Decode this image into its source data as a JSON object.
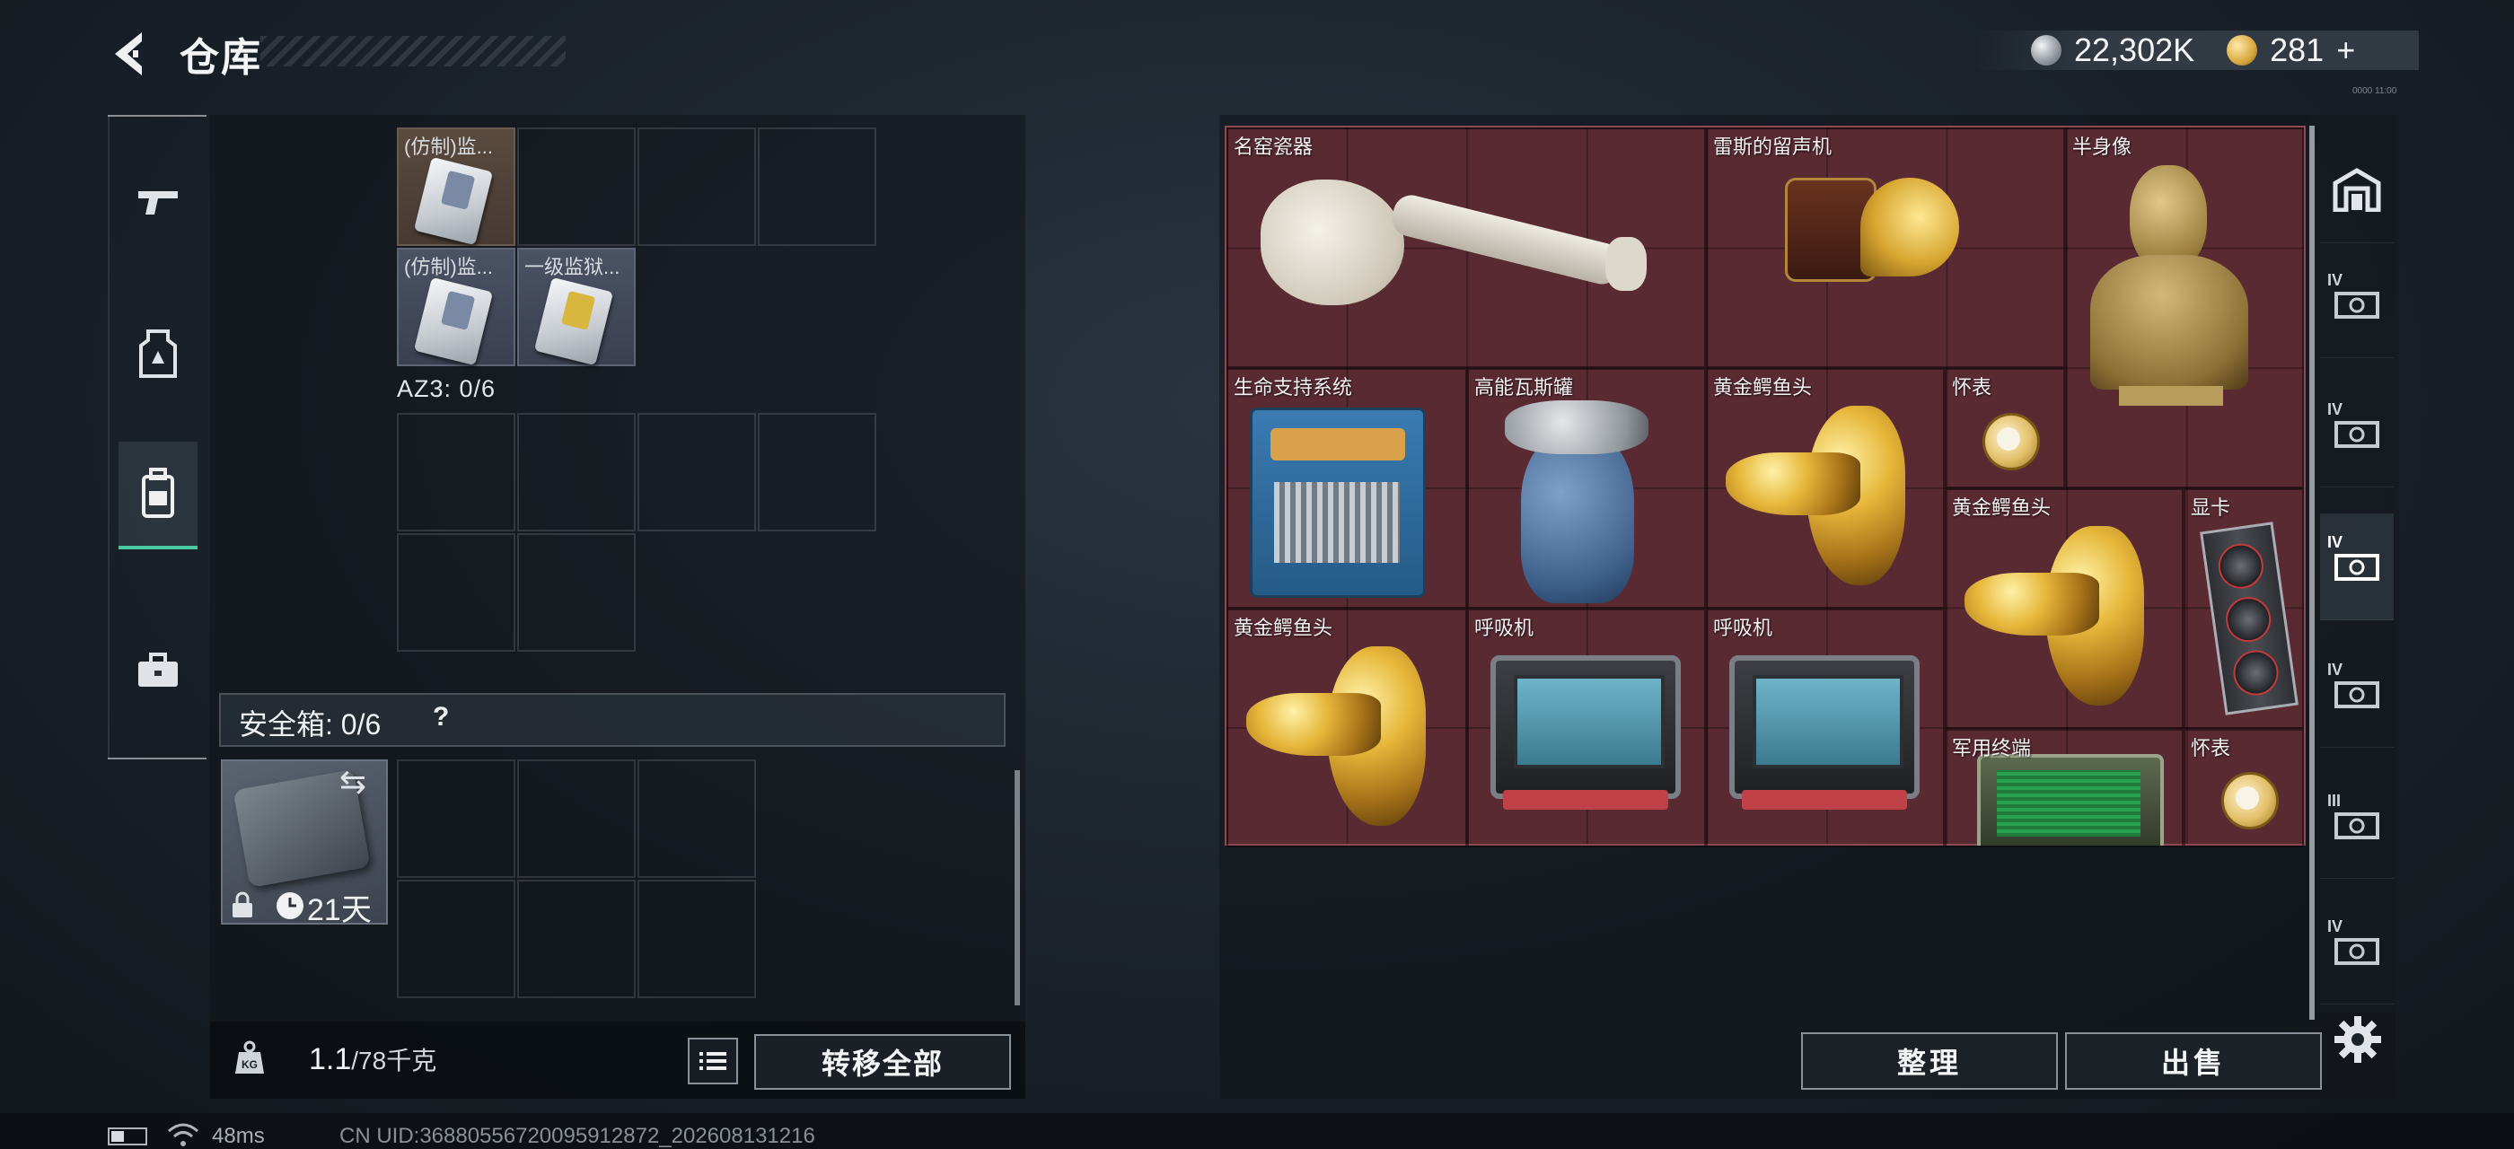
{
  "header": {
    "title": "仓库",
    "silver_amount": "22,302K",
    "gold_amount": "281",
    "gold_add": "+",
    "build_tag": "0000 11:00"
  },
  "left_tabs": [
    {
      "id": "weapons",
      "icon": "pistol-icon"
    },
    {
      "id": "armor",
      "icon": "vest-icon"
    },
    {
      "id": "backpack",
      "icon": "backpack-icon",
      "active": true
    },
    {
      "id": "toolbox",
      "icon": "briefcase-icon"
    }
  ],
  "backpack": {
    "items": [
      {
        "name": "(仿制)监...",
        "color": "orange"
      },
      {
        "name": "(仿制)监...",
        "color": "purple"
      },
      {
        "name": "一级监狱...",
        "color": "purple"
      }
    ],
    "az3_label": "AZ3: 0/6"
  },
  "safebox": {
    "label": "安全箱: 0/6",
    "help": "?",
    "days": "21天"
  },
  "footer_left": {
    "weight_value": "1.1",
    "weight_capacity": "/78千克",
    "transfer_all_label": "转移全部"
  },
  "loot": [
    {
      "name": "名窑瓷器"
    },
    {
      "name": "雷斯的留声机"
    },
    {
      "name": "半身像"
    },
    {
      "name": "生命支持系统"
    },
    {
      "name": "高能瓦斯罐"
    },
    {
      "name": "黄金鳄鱼头"
    },
    {
      "name": "怀表"
    },
    {
      "name": "黄金鳄鱼头"
    },
    {
      "name": "显卡"
    },
    {
      "name": "黄金鳄鱼头"
    },
    {
      "name": "呼吸机"
    },
    {
      "name": "呼吸机"
    },
    {
      "name": "军用终端"
    },
    {
      "name": "怀表"
    }
  ],
  "right_tabs": [
    {
      "icon": "container-icon",
      "level": ""
    },
    {
      "icon": "crate-icon",
      "level": "IV"
    },
    {
      "icon": "crate-icon",
      "level": "IV"
    },
    {
      "icon": "crate-icon",
      "level": "IV",
      "active": true
    },
    {
      "icon": "crate-icon",
      "level": "IV"
    },
    {
      "icon": "crate-icon",
      "level": "III"
    },
    {
      "icon": "crate-icon",
      "level": "IV"
    }
  ],
  "footer_right": {
    "organize_label": "整理",
    "sell_label": "出售"
  },
  "status": {
    "ping": "48ms",
    "uid": "CN UID:36880556720095912872_202608131216"
  },
  "colors": {
    "accent": "#49c8a2",
    "loot_bg": "#5a2a33"
  }
}
